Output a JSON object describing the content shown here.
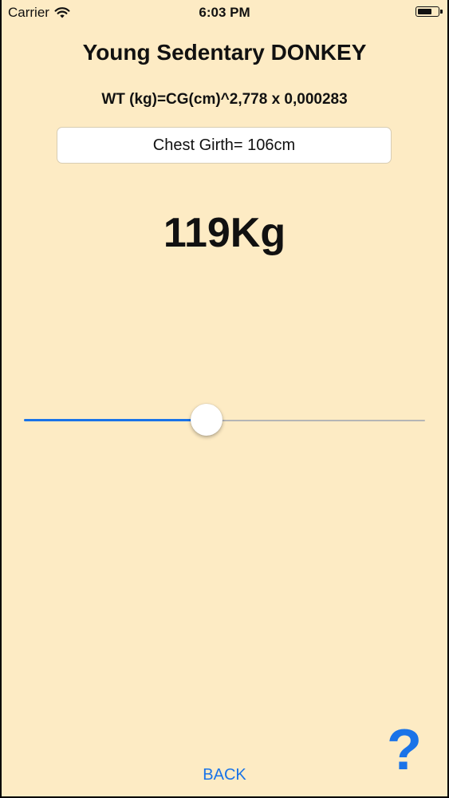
{
  "status_bar": {
    "carrier": "Carrier",
    "time": "6:03 PM",
    "icons": [
      "wifi-icon",
      "battery-icon"
    ]
  },
  "title": "Young Sedentary DONKEY",
  "formula": "WT (kg)=CG(cm)^2,778 x 0,000283",
  "girth_field": {
    "value": "Chest Girth= 106cm"
  },
  "result": {
    "weight": "119Kg"
  },
  "slider": {
    "value_fraction": 0.455
  },
  "footer": {
    "back_label": "BACK",
    "help_label": "?"
  },
  "colors": {
    "background": "#fdebc4",
    "accent": "#1a73e8",
    "track_inactive": "#b5b5b5"
  }
}
